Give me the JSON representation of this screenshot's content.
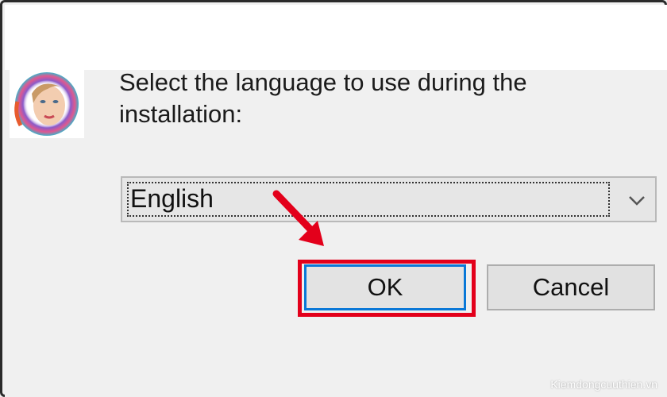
{
  "dialog": {
    "prompt_line1": "Select the language to use during the",
    "prompt_line2": "installation:",
    "language_selected": "English",
    "ok_label": "OK",
    "cancel_label": "Cancel"
  },
  "icons": {
    "app_icon": "app-logo-icon",
    "dropdown": "chevron-down-icon",
    "annotation": "red-arrow-icon"
  },
  "colors": {
    "highlight": "#e3001b",
    "focus_border": "#0a78d7"
  },
  "watermark": {
    "text": "Kiemdongcuuthien.vn"
  }
}
